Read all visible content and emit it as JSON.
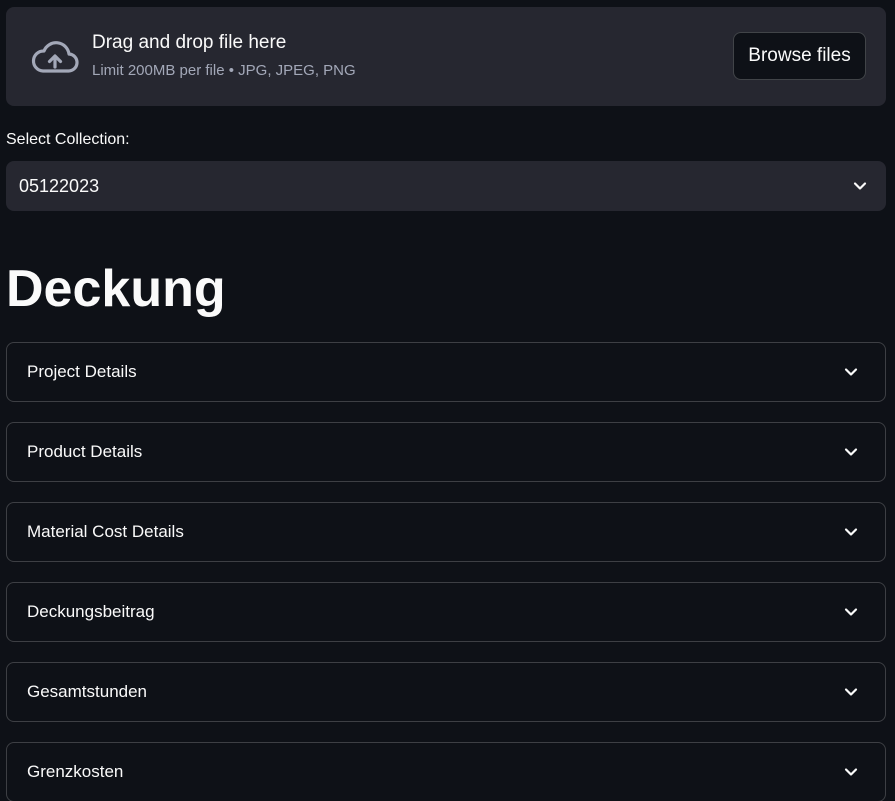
{
  "uploader": {
    "title": "Drag and drop file here",
    "subtitle": "Limit 200MB per file • JPG, JPEG, PNG",
    "browse_label": "Browse files",
    "icon": "cloud-upload-icon"
  },
  "collection": {
    "label": "Select Collection:",
    "selected": "05122023",
    "icon": "chevron-down-icon"
  },
  "page_title": "Deckung",
  "sections": [
    {
      "label": "Project Details"
    },
    {
      "label": "Product Details"
    },
    {
      "label": "Material Cost Details"
    },
    {
      "label": "Deckungsbeitrag"
    },
    {
      "label": "Gesamtstunden"
    },
    {
      "label": "Grenzkosten"
    }
  ],
  "colors": {
    "background": "#0e1117",
    "surface": "#262730",
    "text": "#fafafa",
    "muted": "#a3a8b8"
  }
}
